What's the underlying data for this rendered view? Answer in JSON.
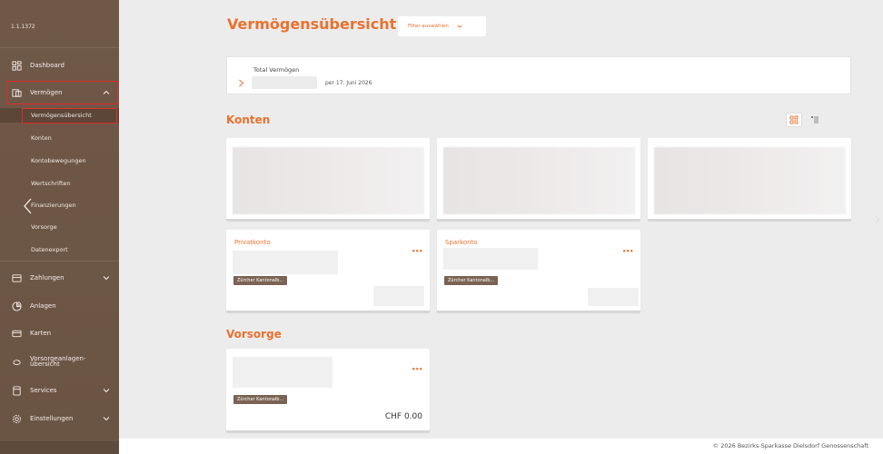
{
  "sidebar": {
    "version": "1.1.1372",
    "items": [
      {
        "label": "Dashboard",
        "icon": "dashboard-icon"
      },
      {
        "label": "Vermögen",
        "icon": "wallet-icon"
      },
      {
        "label": "Zahlungen",
        "icon": "payments-icon"
      },
      {
        "label": "Anlagen",
        "icon": "investments-icon"
      },
      {
        "label": "Karten",
        "icon": "card-icon"
      },
      {
        "label": "Vorsorgeanlagen-übersicht",
        "icon": "pension-icon"
      },
      {
        "label": "Services",
        "icon": "services-icon"
      },
      {
        "label": "Einstellungen",
        "icon": "settings-icon"
      }
    ],
    "sub_items": [
      {
        "label": "Vermögensübersicht"
      },
      {
        "label": "Konten"
      },
      {
        "label": "Kontobewegungen"
      },
      {
        "label": "Wertschriften"
      },
      {
        "label": "Finanzierungen"
      },
      {
        "label": "Vorsorge"
      },
      {
        "label": "Datenexport"
      }
    ]
  },
  "main": {
    "title": "Vermögensübersicht",
    "filter_label": "Filter auswählen",
    "total": {
      "label": "Total Vermögen",
      "date": "per 17. Juni 2026"
    },
    "sections": {
      "konten": "Konten",
      "vorsorge": "Vorsorge"
    },
    "accounts": [
      {
        "name": "Privatkonto",
        "bank": "Zürcher Kantonalb..."
      },
      {
        "name": "Sparkonto",
        "bank": "Zürcher Kantonalb..."
      }
    ],
    "vorsorge_card": {
      "bank": "Zürcher Kantonalb...",
      "amount": "CHF 0.00"
    },
    "menu_dots": "•••"
  },
  "footer": {
    "text": "© 2026 Bezirks-Sparkasse Dielsdorf Genossenschaft"
  },
  "colors": {
    "accent": "#e8722f",
    "sidebar_bg": "#6b5545",
    "highlight_border": "#e02b2b",
    "badge_bg": "#7b6354"
  }
}
